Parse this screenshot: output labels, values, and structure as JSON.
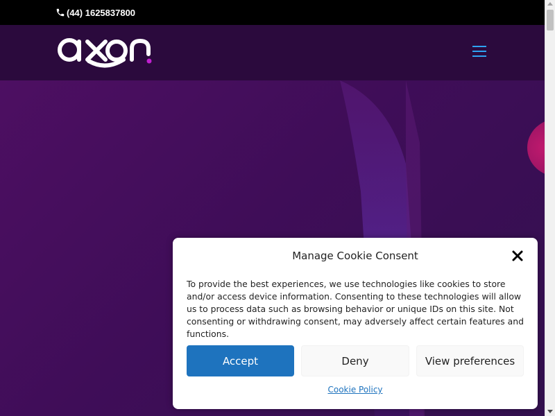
{
  "topbar": {
    "phone_icon": "phone-icon",
    "phone": "(44) 1625837800"
  },
  "header": {
    "logo_text": "axon",
    "menu_icon": "hamburger-menu-icon",
    "menu_color": "#2ea3f2"
  },
  "colors": {
    "brand_purple": "#2b0a3d",
    "accent_magenta": "#c020d0",
    "button_blue": "#1e73be"
  },
  "cookie": {
    "title": "Manage Cookie Consent",
    "body": "To provide the best experiences, we use technologies like cookies to store and/or access device information. Consenting to these technologies will allow us to process data such as browsing behavior or unique IDs on this site. Not consenting or withdrawing consent, may adversely affect certain features and functions.",
    "accept_label": "Accept",
    "deny_label": "Deny",
    "preferences_label": "View preferences",
    "policy_link": "Cookie Policy",
    "close_icon": "close-icon"
  }
}
